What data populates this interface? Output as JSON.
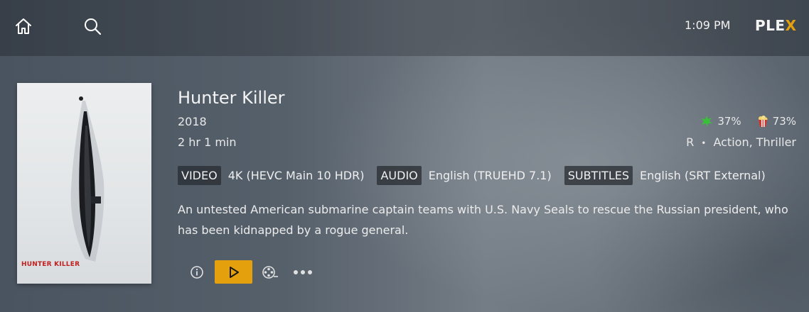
{
  "header": {
    "time": "1:09 PM",
    "logo_text": "PLE",
    "logo_accent": "X",
    "accent_color": "#e5a00d",
    "icons": [
      "home-icon",
      "search-icon"
    ]
  },
  "poster": {
    "title_text": "HUNTER KILLER"
  },
  "movie": {
    "title": "Hunter Killer",
    "year": "2018",
    "duration": "2 hr 1 min",
    "critic_rating": "37%",
    "audience_rating": "73%",
    "content_rating": "R",
    "separator": "•",
    "genres": "Action, Thriller",
    "summary": "An untested American submarine captain teams with U.S. Navy Seals to rescue the Russian president, who has been kidnapped by a rogue general."
  },
  "streams": {
    "video_label": "VIDEO",
    "video_value": "4K (HEVC Main 10 HDR)",
    "audio_label": "AUDIO",
    "audio_value": "English (TRUEHD 7.1)",
    "subtitles_label": "SUBTITLES",
    "subtitles_value": "English (SRT External)"
  },
  "actions": [
    "info-icon",
    "play-icon",
    "trailer-reel-icon",
    "more-icon"
  ]
}
